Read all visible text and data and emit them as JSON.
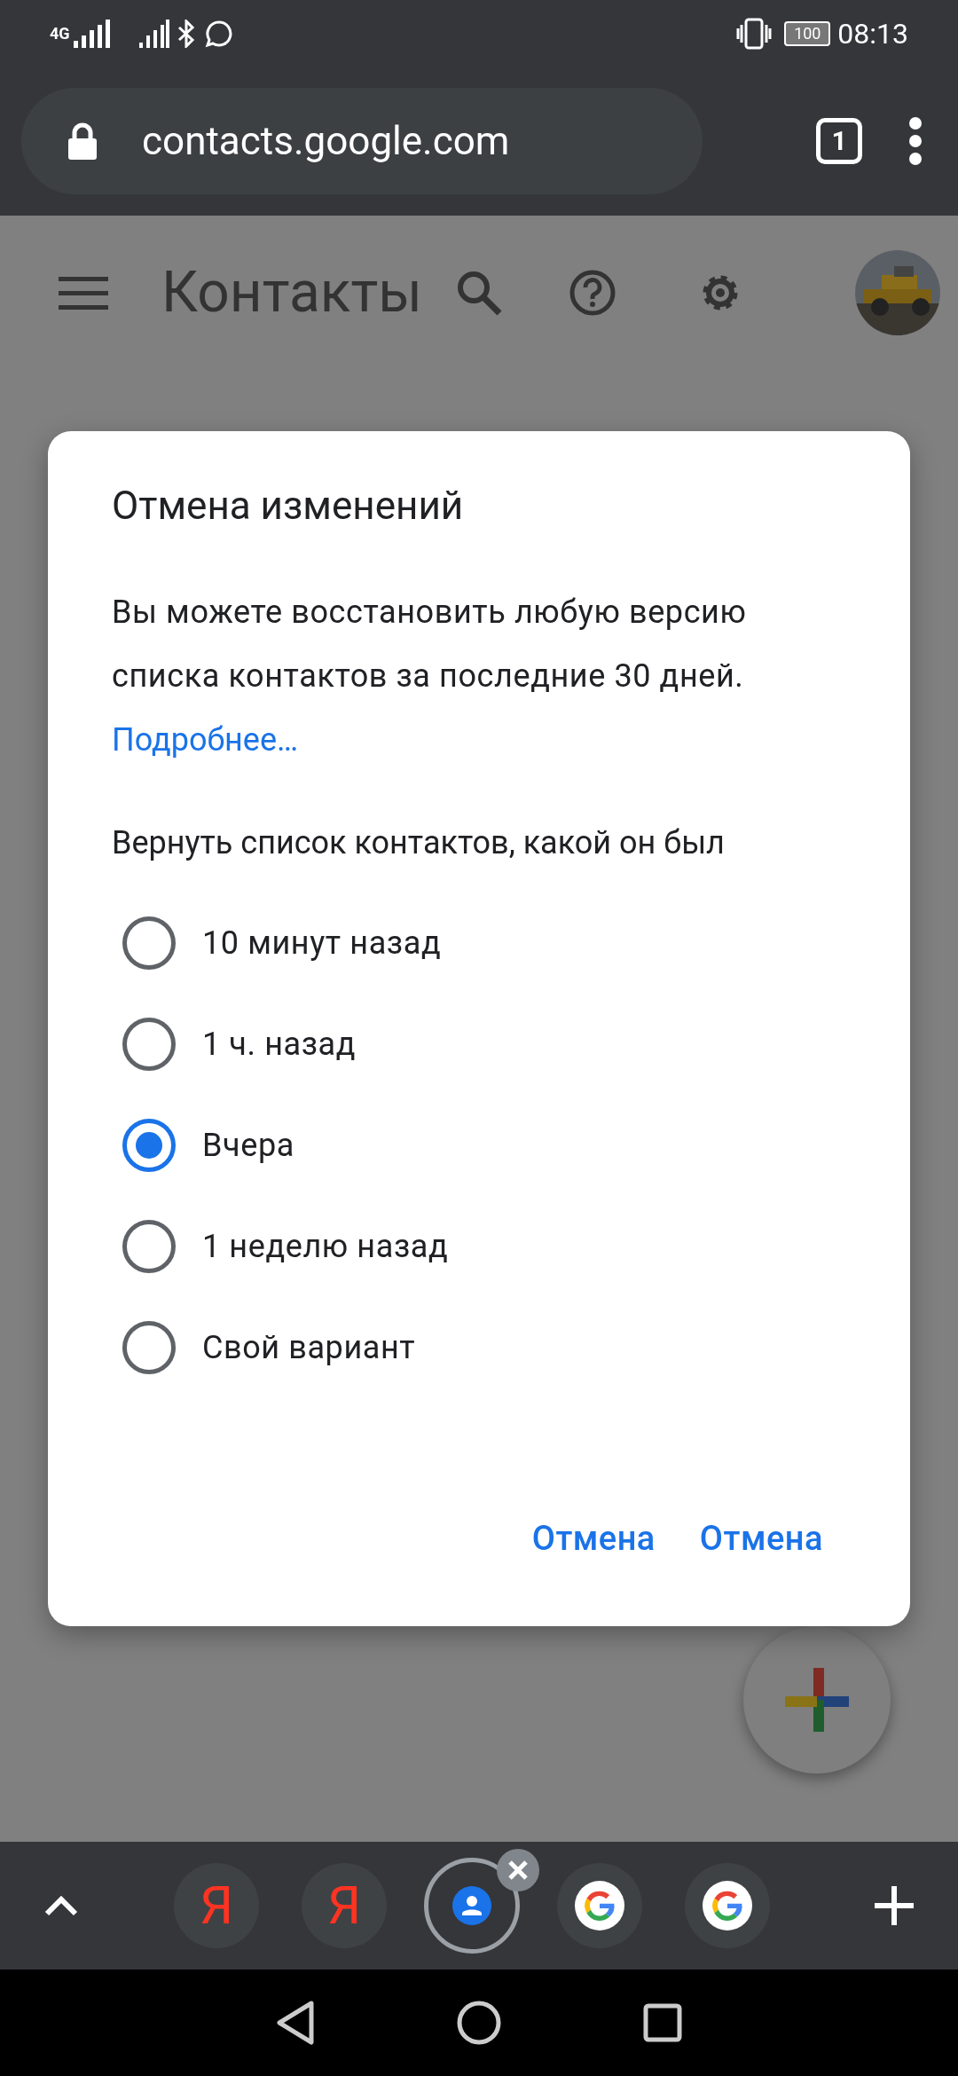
{
  "status_bar": {
    "network": "4G",
    "battery": "100",
    "time": "08:13"
  },
  "browser": {
    "url": "contacts.google.com",
    "tab_count": "1"
  },
  "app_header": {
    "title": "Контакты"
  },
  "dialog": {
    "title": "Отмена изменений",
    "body": "Вы можете восстановить любую версию списка контактов за последние 30 дней.",
    "link": "Подробнее…",
    "prompt": "Вернуть список контактов, какой он был",
    "options": [
      {
        "label": "10 минут назад",
        "selected": false
      },
      {
        "label": "1 ч. назад",
        "selected": false
      },
      {
        "label": "Вчера",
        "selected": true
      },
      {
        "label": "1 неделю назад",
        "selected": false
      },
      {
        "label": "Свой вариант",
        "selected": false
      }
    ],
    "buttons": [
      "Отмена",
      "Отмена"
    ]
  },
  "tab_strip": {
    "tabs": [
      {
        "kind": "yandex",
        "label": "Я",
        "selected": false
      },
      {
        "kind": "yandex",
        "label": "Я",
        "selected": false
      },
      {
        "kind": "contacts",
        "selected": true
      },
      {
        "kind": "google",
        "selected": false
      },
      {
        "kind": "google",
        "selected": false
      }
    ]
  }
}
